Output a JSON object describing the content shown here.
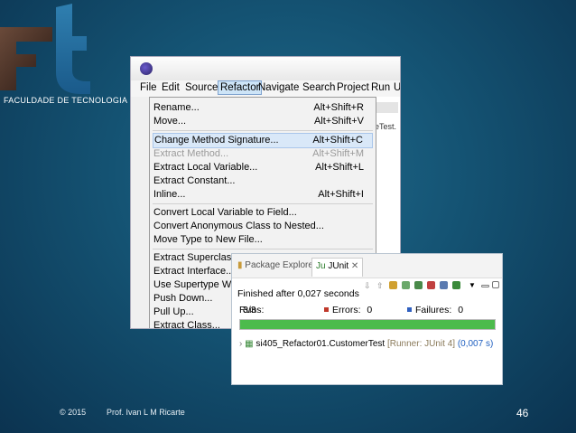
{
  "logo": {
    "caption": "FACULDADE DE TECNOLOGIA"
  },
  "window": {
    "menubar": [
      "File",
      "Edit",
      "Source",
      "Refactor",
      "Navigate",
      "Search",
      "Project",
      "Run",
      "U"
    ],
    "active_menu": "Refactor",
    "editor_tab_text": "eTest."
  },
  "refactor_menu": [
    {
      "label": "Rename...",
      "accel": "Alt+Shift+R",
      "state": "normal"
    },
    {
      "label": "Move...",
      "accel": "Alt+Shift+V",
      "state": "normal"
    },
    {
      "label": "Change Method Signature...",
      "accel": "Alt+Shift+C",
      "state": "highlighted"
    },
    {
      "label": "Extract Method...",
      "accel": "Alt+Shift+M",
      "state": "disabled"
    },
    {
      "label": "Extract Local Variable...",
      "accel": "Alt+Shift+L",
      "state": "normal"
    },
    {
      "label": "Extract Constant...",
      "accel": "",
      "state": "normal"
    },
    {
      "label": "Inline...",
      "accel": "Alt+Shift+I",
      "state": "normal"
    },
    {
      "label": "Convert Local Variable to Field...",
      "accel": "",
      "state": "normal"
    },
    {
      "label": "Convert Anonymous Class to Nested...",
      "accel": "",
      "state": "normal"
    },
    {
      "label": "Move Type to New File...",
      "accel": "",
      "state": "normal"
    },
    {
      "label": "Extract Superclass...",
      "accel": "",
      "state": "normal"
    },
    {
      "label": "Extract Interface...",
      "accel": "",
      "state": "normal"
    },
    {
      "label": "Use Supertype Where",
      "accel": "",
      "state": "normal"
    },
    {
      "label": "Push Down...",
      "accel": "",
      "state": "normal"
    },
    {
      "label": "Pull Up...",
      "accel": "",
      "state": "normal"
    },
    {
      "label": "Extract Class...",
      "accel": "",
      "state": "normal"
    }
  ],
  "junit": {
    "tabs": {
      "package_explorer": "Package Explorer",
      "junit": "JUnit"
    },
    "finished": "Finished after 0,027 seconds",
    "runs_label": "Runs:",
    "runs_value": "3/3",
    "errors_label": "Errors:",
    "errors_value": "0",
    "failures_label": "Failures:",
    "failures_value": "0",
    "progress_fraction": 1.0,
    "progress_color": "#4cbb4c",
    "result": {
      "name": "si405_Refactor01.CustomerTest",
      "runner": "[Runner: JUnit 4]",
      "time": "(0,007 s)"
    }
  },
  "footer": {
    "copyright": "© 2015",
    "author": "Prof. Ivan L M Ricarte",
    "page": "46"
  },
  "colors": {
    "background": "#145272",
    "highlight": "#d9e8f8",
    "errors_marker": "#c0392b",
    "failures_marker": "#3060c0"
  }
}
